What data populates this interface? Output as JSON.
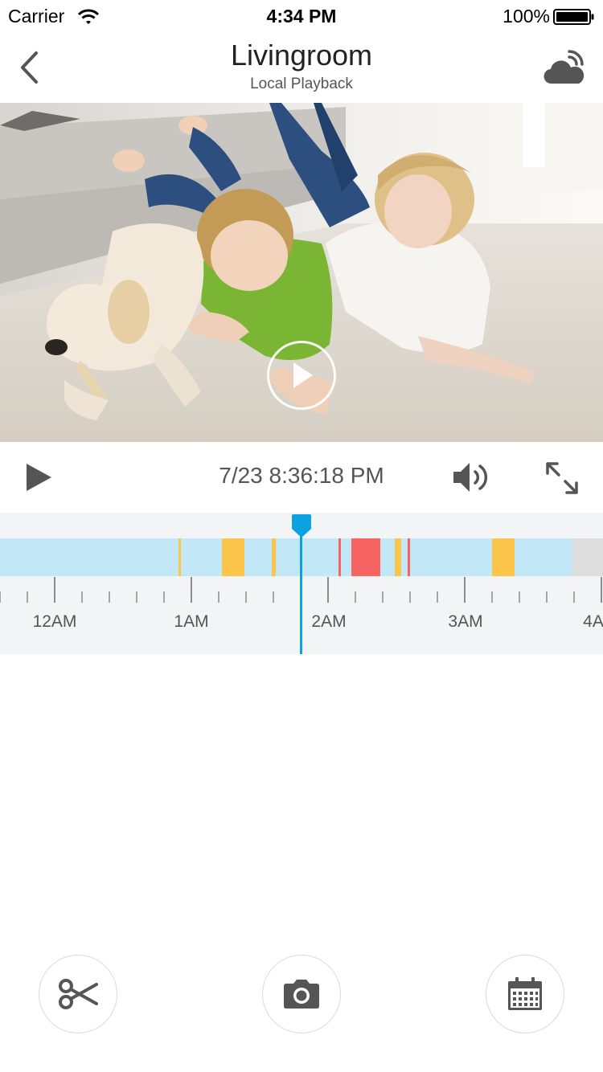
{
  "status_bar": {
    "carrier": "Carrier",
    "time": "4:34 PM",
    "battery": "100%"
  },
  "nav": {
    "title": "Livingroom",
    "subtitle": "Local Playback",
    "back_icon": "chevron-left-icon",
    "cloud_icon": "cloud-signal-icon"
  },
  "video": {
    "overlay_icon": "play-circle-icon"
  },
  "controls": {
    "datetime": "7/23 8:36:18 PM",
    "play_icon": "play-icon",
    "volume_icon": "volume-icon",
    "fullscreen_icon": "expand-icon"
  },
  "timeline": {
    "hour_labels": [
      "12AM",
      "1AM",
      "2AM",
      "3AM",
      "4A"
    ],
    "colors": {
      "track": "#c2e8f8",
      "motion": "#fbc54b",
      "alert": "#f56363",
      "no_record": "#dddddd",
      "cursor": "#0aa2e0"
    }
  },
  "toolbar": {
    "clip_icon": "scissors-icon",
    "snapshot_icon": "camera-icon",
    "calendar_icon": "calendar-icon"
  }
}
